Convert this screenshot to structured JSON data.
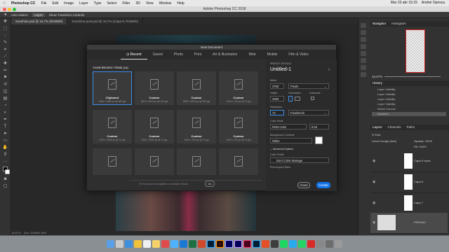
{
  "menubar": {
    "apple": "",
    "items": [
      "Photoshop CC",
      "File",
      "Edit",
      "Image",
      "Layer",
      "Type",
      "Select",
      "Filter",
      "3D",
      "View",
      "Window",
      "Help"
    ],
    "clock": "Mar 23 abr 15:15",
    "user": "Andrei Oprisca"
  },
  "titlebar": {
    "title": "Adobe Photoshop CC 2018"
  },
  "optionsbar": {
    "auto_select": "Auto-Select:",
    "layer": "Layer",
    "show_transform": "Show Transform Controls"
  },
  "doc_tabs": [
    "Sunshine.psd @ 16,7% (RGB/8#)",
    "Sunshine-post.psd @ 16,7% (Capa 8, RGB/8#)"
  ],
  "statusbar": {
    "zoom": "16,67%",
    "doc": "Doc: 54,8M/1,96G"
  },
  "right_panels": {
    "navigator_tabs": [
      "Navigator",
      "Histogram"
    ],
    "zoom": "16,67%",
    "history_tab": "History",
    "history_items": [
      "Layer Visibility",
      "Layer Visibility",
      "Layer Visibility",
      "Layer Visibility",
      "Select Canvas",
      "Deselect"
    ],
    "layers_tabs": [
      "Layers",
      "Channels",
      "Paths"
    ],
    "layer_kind": "Kind",
    "blend_mode": "Linear Dodge (Add)",
    "opacity_label": "Opacity:",
    "opacity": "100%",
    "fill_label": "Fill:",
    "fill": "100%",
    "layers": [
      "Capa 8 copia",
      "Capa 8",
      "Capa 7",
      "FRESNO"
    ]
  },
  "modal": {
    "title": "New Document",
    "tabs": [
      "Recent",
      "Saved",
      "Photo",
      "Print",
      "Art & Illustration",
      "Web",
      "Mobile",
      "Film & Video"
    ],
    "recent_header": "YOUR RECENT ITEMS",
    "recent_count": "(12)",
    "cards": [
      {
        "name": "Clipboard",
        "desc": "1080 x 1080 px @ 300 ppi"
      },
      {
        "name": "Custom",
        "desc": "4624 x 3024 px @ 144 ppi"
      },
      {
        "name": "Custom",
        "desc": "3000 x 2000 px @ 300 ppi"
      },
      {
        "name": "Custom",
        "desc": "1440 x 720 px @ 72 ppi"
      },
      {
        "name": "Custom",
        "desc": "2475 x 3300 px @ 72 ppi"
      },
      {
        "name": "Custom",
        "desc": "3000 x 2000 px @ 72 ppi"
      },
      {
        "name": "Custom",
        "desc": "1440 x 720 px @ 72 ppi"
      },
      {
        "name": "Custom",
        "desc": "1400 x 700 px @ 72 ppi"
      },
      {
        "name": "",
        "desc": ""
      },
      {
        "name": "",
        "desc": ""
      },
      {
        "name": "",
        "desc": ""
      },
      {
        "name": "",
        "desc": ""
      }
    ],
    "search_placeholder": "Find more templates on Adobe Stock",
    "go": "Go",
    "details": {
      "header": "PRESET DETAILS",
      "name": "Untitled-1",
      "width_label": "Width",
      "width": "3750",
      "width_unit": "Pixels",
      "height_label": "Height",
      "height": "3000",
      "orientation_label": "Orientation",
      "artboards_label": "Artboards",
      "resolution_label": "Resolution",
      "resolution": "72",
      "resolution_unit": "Pixels/Inch",
      "color_mode_label": "Color Mode",
      "color_mode": "RGB Color",
      "bit_depth": "8 bit",
      "bg_label": "Background Contents",
      "bg": "White",
      "advanced_label": "Advanced Options",
      "profile_label": "Color Profile",
      "profile": "Don't Color Manage",
      "pixel_ratio_label": "Pixel Aspect Ratio"
    },
    "close": "Close",
    "create": "Create"
  }
}
